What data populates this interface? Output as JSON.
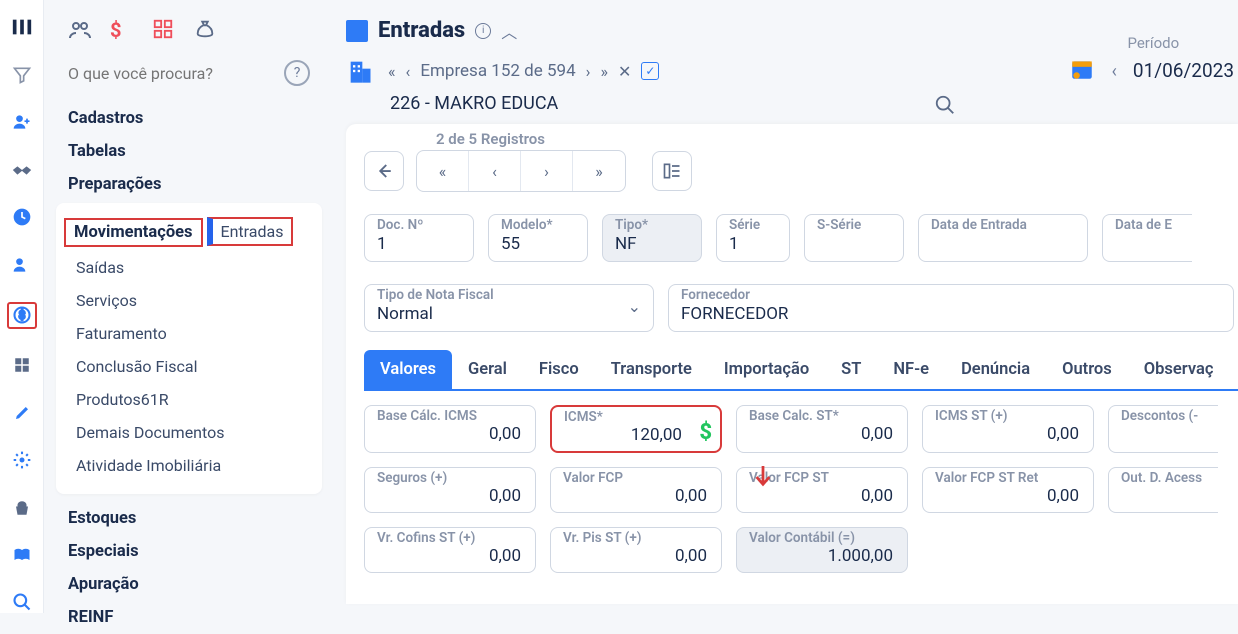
{
  "header": {
    "title": "Entradas",
    "search_placeholder": "O que você procura?"
  },
  "nav": {
    "cadastros": "Cadastros",
    "tabelas": "Tabelas",
    "preparacoes": "Preparações",
    "movimentacoes": "Movimentações",
    "sub": {
      "entradas": "Entradas",
      "saidas": "Saídas",
      "servicos": "Serviços",
      "faturamento": "Faturamento",
      "conclusao": "Conclusão Fiscal",
      "produtos61r": "Produtos61R",
      "demais": "Demais Documentos",
      "atividade": "Atividade Imobiliária"
    },
    "estoques": "Estoques",
    "especiais": "Especiais",
    "apuracao": "Apuração",
    "reinf": "REINF"
  },
  "company": {
    "pager": "Empresa 152 de 594",
    "name": "226 - MAKRO EDUCA"
  },
  "period": {
    "label": "Período",
    "date": "01/06/2023"
  },
  "records": {
    "label": "2 de 5 Registros"
  },
  "doc": {
    "docn_label": "Doc. Nº",
    "docn": "1",
    "modelo_label": "Modelo*",
    "modelo": "55",
    "tipo_label": "Tipo*",
    "tipo": "NF",
    "serie_label": "Série",
    "serie": "1",
    "sserie_label": "S-Série",
    "sserie": "",
    "dataent_label": "Data de Entrada",
    "dataent": "",
    "datae_label": "Data de E",
    "tiponf_label": "Tipo de Nota Fiscal",
    "tiponf": "Normal",
    "forn_label": "Fornecedor",
    "forn": "FORNECEDOR"
  },
  "tabs": {
    "valores": "Valores",
    "geral": "Geral",
    "fisco": "Fisco",
    "transporte": "Transporte",
    "importacao": "Importação",
    "st": "ST",
    "nfe": "NF-e",
    "denuncia": "Denúncia",
    "outros": "Outros",
    "obs": "Observaç"
  },
  "values": {
    "bcicms_label": "Base Cálc. ICMS",
    "bcicms": "0,00",
    "icms_label": "ICMS*",
    "icms": "120,00",
    "bcst_label": "Base Calc. ST*",
    "bcst": "0,00",
    "icmsst_label": "ICMS ST (+)",
    "icmsst": "0,00",
    "desc_label": "Descontos (-",
    "seguros_label": "Seguros (+)",
    "seguros": "0,00",
    "fcp_label": "Valor FCP",
    "fcp": "0,00",
    "fcpst_label": "Valor FCP ST",
    "fcpst": "0,00",
    "fcpstret_label": "Valor FCP ST Ret",
    "fcpstret": "0,00",
    "outacess_label": "Out. D. Acess",
    "cofst_label": "Vr. Cofins ST (+)",
    "cofst": "0,00",
    "pisst_label": "Vr. Pis ST (+)",
    "pisst": "0,00",
    "vcontabil_label": "Valor Contábil (=)",
    "vcontabil": "1.000,00"
  }
}
